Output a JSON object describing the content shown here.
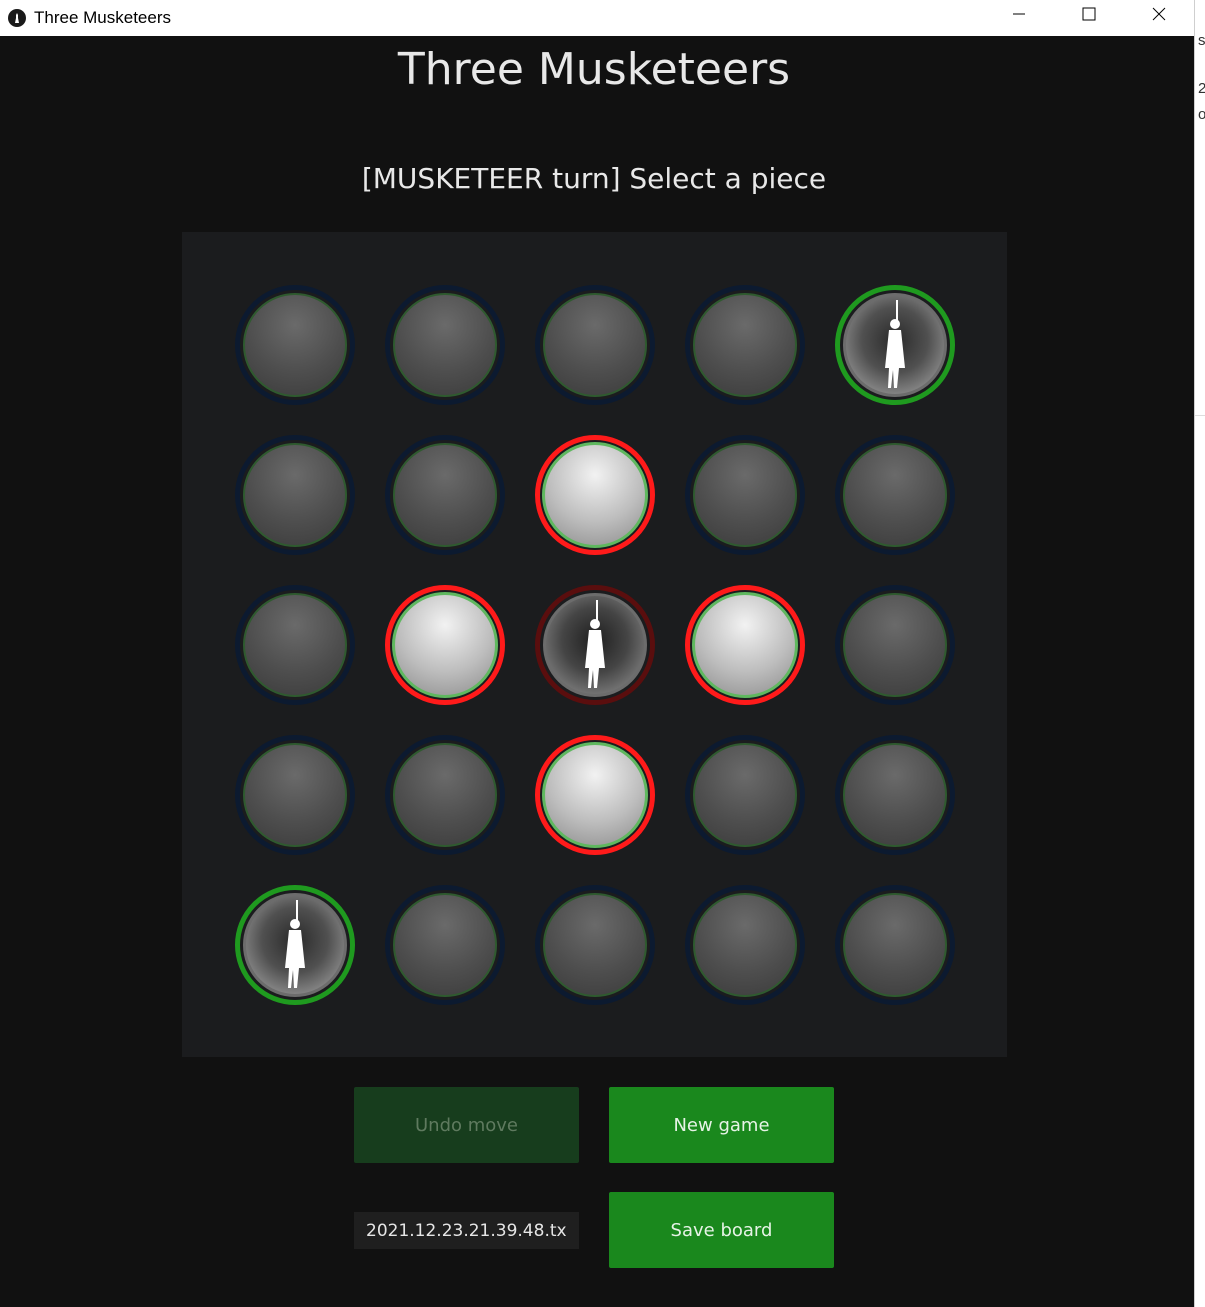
{
  "window": {
    "title": "Three Musketeers",
    "icon": "musketeer-app-icon",
    "controls": [
      "minimize-icon",
      "maximize-icon",
      "close-icon"
    ]
  },
  "background_window": {
    "fragments": [
      "s",
      "2",
      "o"
    ]
  },
  "game": {
    "title": "Three Musketeers",
    "status": "[MUSKETEER turn] Select a piece"
  },
  "board": {
    "size": 5,
    "rows": [
      [
        "empty",
        "empty",
        "empty",
        "empty",
        "musketeer"
      ],
      [
        "empty",
        "empty",
        "guard",
        "empty",
        "empty"
      ],
      [
        "empty",
        "guard",
        "musketeer-selected",
        "guard",
        "empty"
      ],
      [
        "empty",
        "empty",
        "guard",
        "empty",
        "empty"
      ],
      [
        "musketeer",
        "empty",
        "empty",
        "empty",
        "empty"
      ]
    ]
  },
  "controls": {
    "undo_label": "Undo move",
    "new_game_label": "New game",
    "save_label": "Save board",
    "file_value": "2021.12.23.21.39.48.txt"
  },
  "colors": {
    "window_bg": "#111111",
    "board_bg": "#1b1c1e",
    "button_green": "#1a881d",
    "button_disabled": "#173d1d",
    "guard_ring": "#ff1a1a",
    "musketeer_ring": "#1f9a1f"
  }
}
